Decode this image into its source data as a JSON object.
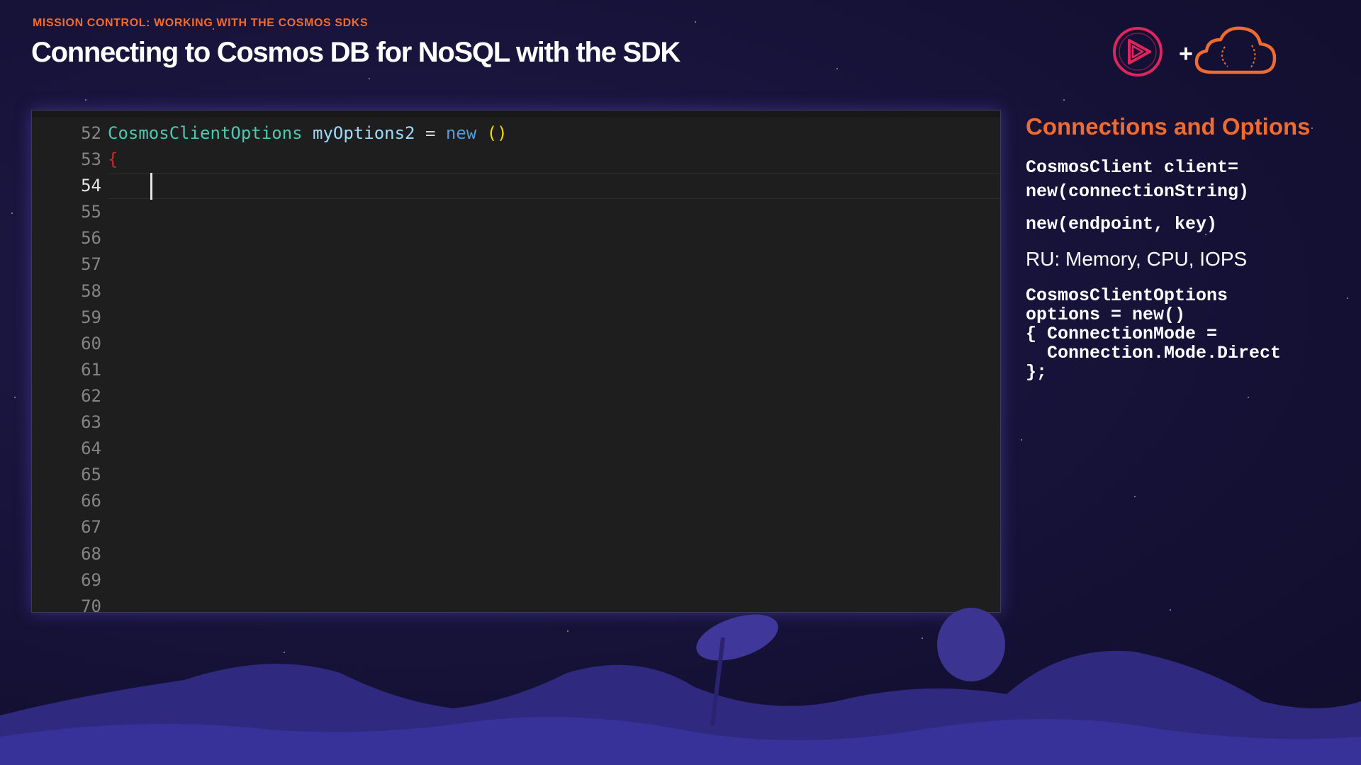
{
  "header": {
    "kicker": "MISSION CONTROL: WORKING WITH THE COSMOS SDKS",
    "title": "Connecting to Cosmos DB for NoSQL with the SDK",
    "plus": "+"
  },
  "editor": {
    "line_numbers": [
      "52",
      "53",
      "54",
      "55",
      "56",
      "57",
      "58",
      "59",
      "60",
      "61",
      "62",
      "63",
      "64",
      "65",
      "66",
      "67",
      "68",
      "69",
      "70"
    ],
    "active_line": "54",
    "line52": {
      "type": "CosmosClientOptions",
      "var": "myOptions2",
      "op": "=",
      "kw": "new",
      "parens": "()"
    },
    "line53": {
      "brace": "{"
    }
  },
  "side_panel": {
    "heading": "Connections and Options",
    "block1_line1": "CosmosClient client=",
    "block1_line2": "new(connectionString)",
    "block2": "new(endpoint, key)",
    "block3": "RU: Memory, CPU, IOPS",
    "block4_line1": "CosmosClientOptions",
    "block4_line2": "options = new()",
    "block4_line3": "{ ConnectionMode =",
    "block4_line4": "  Connection.Mode.Direct",
    "block4_line5": "};"
  },
  "colors": {
    "accent": "#f26b2e",
    "editor_bg": "#1e1e1e",
    "page_bg": "#17133a"
  },
  "icons": [
    "play-circle-icon",
    "cloud-icon"
  ]
}
